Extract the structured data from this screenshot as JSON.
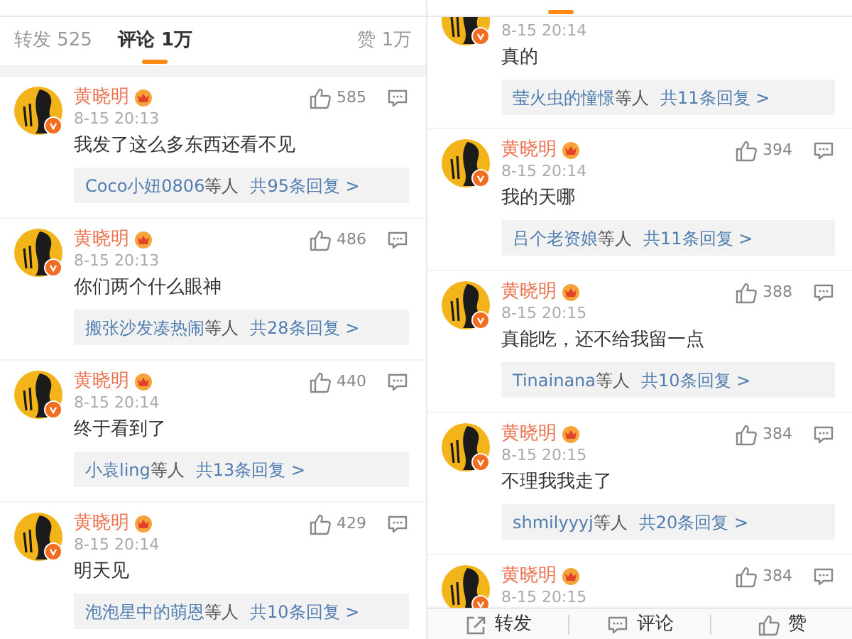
{
  "left_panel": {
    "tabs": [
      {
        "label": "转发 525",
        "selected": false
      },
      {
        "label": "评论 1万",
        "selected": true
      },
      {
        "label": "赞 1万",
        "selected": false
      }
    ],
    "comments": [
      {
        "name": "黄晓明",
        "time": "8-15 20:13",
        "likes": "585",
        "text": "我发了这么多东西还看不见",
        "reply": {
          "users": "Coco小妞0806",
          "suffix": "等人",
          "total": "共95条回复 >"
        }
      },
      {
        "name": "黄晓明",
        "time": "8-15 20:13",
        "likes": "486",
        "text": "你们两个什么眼神",
        "reply": {
          "users": "搬张沙发凑热闹",
          "suffix": "等人",
          "total": "共28条回复 >"
        }
      },
      {
        "name": "黄晓明",
        "time": "8-15 20:14",
        "likes": "440",
        "text": "终于看到了",
        "reply": {
          "users": "小袁ling",
          "suffix": "等人",
          "total": "共13条回复 >"
        }
      },
      {
        "name": "黄晓明",
        "time": "8-15 20:14",
        "likes": "429",
        "text": "明天见",
        "reply": {
          "users": "泡泡星中的萌恩",
          "suffix": "等人",
          "total": "共10条回复 >"
        }
      }
    ]
  },
  "right_panel": {
    "comments": [
      {
        "time": "8-15 20:14",
        "text": "真的",
        "reply": {
          "users": "莹火虫的憧憬",
          "suffix": "等人",
          "total": "共11条回复 >"
        }
      },
      {
        "name": "黄晓明",
        "time": "8-15 20:14",
        "likes": "394",
        "text": "我的天哪",
        "reply": {
          "users": "吕个老资娘",
          "suffix": "等人",
          "total": "共11条回复 >"
        }
      },
      {
        "name": "黄晓明",
        "time": "8-15 20:15",
        "likes": "388",
        "text": "真能吃，还不给我留一点",
        "reply": {
          "users": "Tinainana",
          "suffix": "等人",
          "total": "共10条回复 >"
        }
      },
      {
        "name": "黄晓明",
        "time": "8-15 20:15",
        "likes": "384",
        "text": "不理我我走了",
        "reply": {
          "users": "shmilyyyj",
          "suffix": "等人",
          "total": "共20条回复 >"
        }
      },
      {
        "name": "黄晓明",
        "time": "8-15 20:15",
        "likes": "384"
      }
    ],
    "bottom_bar": [
      {
        "kind": "share",
        "label": "转发"
      },
      {
        "kind": "comment",
        "label": "评论"
      },
      {
        "kind": "like",
        "label": "赞"
      }
    ]
  }
}
